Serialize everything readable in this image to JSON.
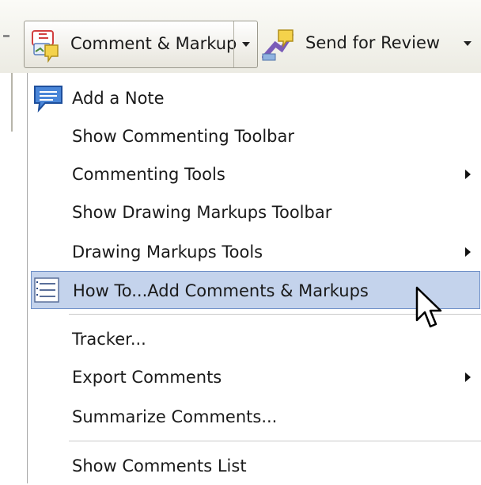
{
  "toolbar": {
    "comment_markup_label": "Comment & Markup",
    "send_review_label": "Send for Review"
  },
  "menu": {
    "items": [
      {
        "label": "Add a Note",
        "submenu": false
      },
      {
        "label": "Show Commenting Toolbar",
        "submenu": false
      },
      {
        "label": "Commenting Tools",
        "submenu": true
      },
      {
        "label": "Show Drawing Markups Toolbar",
        "submenu": false
      },
      {
        "label": "Drawing Markups Tools",
        "submenu": true
      },
      {
        "label": "How To...Add Comments & Markups",
        "submenu": false,
        "highlighted": true
      },
      {
        "label": "Tracker...",
        "submenu": false
      },
      {
        "label": "Export Comments",
        "submenu": true
      },
      {
        "label": "Summarize Comments...",
        "submenu": false
      },
      {
        "label": "Show Comments List",
        "submenu": false
      }
    ]
  },
  "colors": {
    "highlight": "#c4d3ec",
    "highlight_border": "#6e8fc7"
  }
}
